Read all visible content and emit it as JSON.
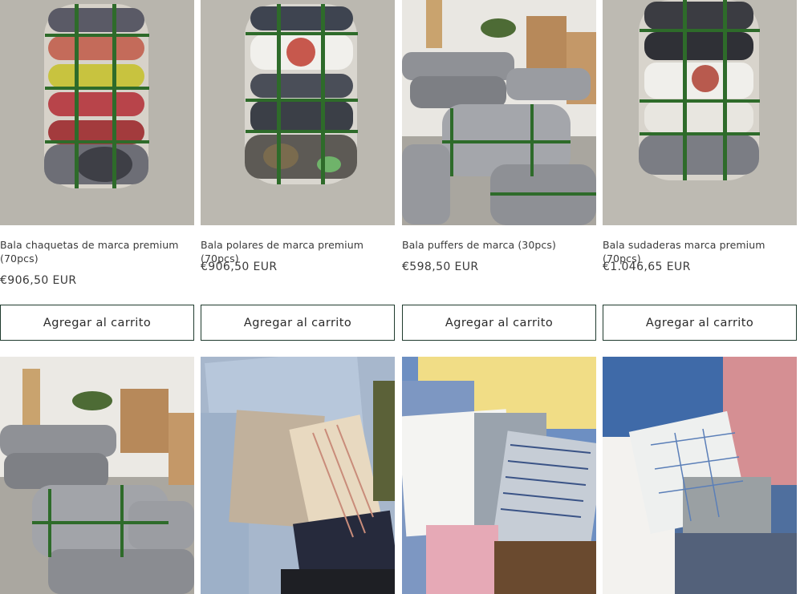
{
  "products": [
    {
      "title": "Bala chaquetas de marca premium (70pcs)",
      "price": "€906,50 EUR",
      "button": "Agregar al carrito",
      "image": "bale-photo"
    },
    {
      "title": "Bala polares de marca premium (70pcs)",
      "price": "€906,50 EUR",
      "button": "Agregar al carrito",
      "image": "bale-photo"
    },
    {
      "title": "Bala puffers de marca (30pcs)",
      "price": "€598,50 EUR",
      "button": "Agregar al carrito",
      "image": "warehouse-bales-photo"
    },
    {
      "title": "Bala sudaderas marca premium (70pcs)",
      "price": "€1.046,65 EUR",
      "button": "Agregar al carrito",
      "image": "bale-photo"
    }
  ],
  "second_row": [
    {
      "image": "warehouse-bales-photo"
    },
    {
      "image": "shirts-pile-photo"
    },
    {
      "image": "shirts-pile-photo"
    },
    {
      "image": "shirts-pile-photo"
    }
  ],
  "colors": {
    "button_border": "#1f3b2e",
    "strap_green": "#2e6b2a",
    "floor_grey": "#b9b6ae"
  }
}
